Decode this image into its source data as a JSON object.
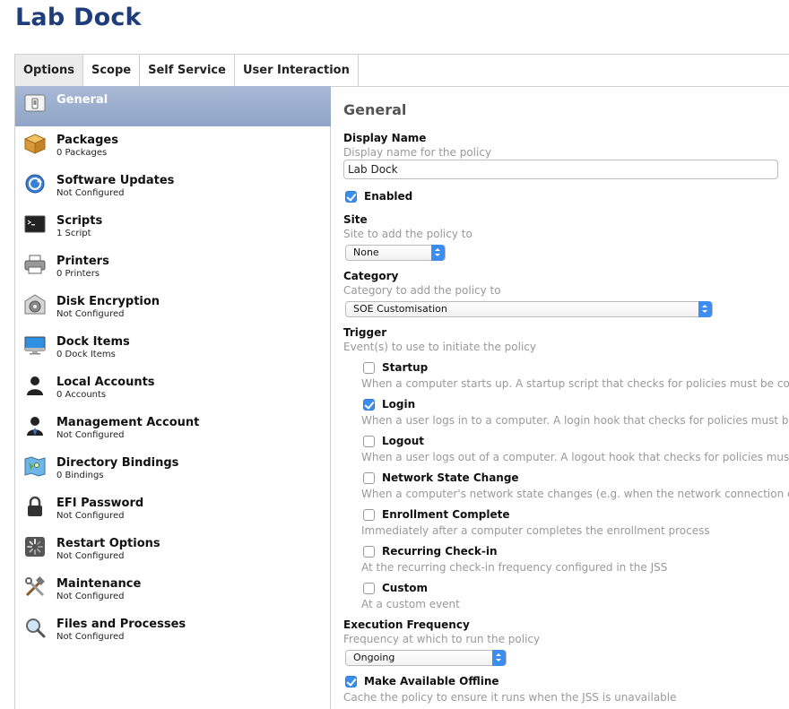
{
  "page": {
    "title": "Lab Dock"
  },
  "tabs": [
    {
      "label": "Options"
    },
    {
      "label": "Scope"
    },
    {
      "label": "Self Service"
    },
    {
      "label": "User Interaction"
    }
  ],
  "sidebar": {
    "items": [
      {
        "label": "General",
        "sub": "",
        "icon": "switch-icon"
      },
      {
        "label": "Packages",
        "sub": "0 Packages",
        "icon": "package-icon"
      },
      {
        "label": "Software Updates",
        "sub": "Not Configured",
        "icon": "software-update-icon"
      },
      {
        "label": "Scripts",
        "sub": "1 Script",
        "icon": "terminal-icon"
      },
      {
        "label": "Printers",
        "sub": "0 Printers",
        "icon": "printer-icon"
      },
      {
        "label": "Disk Encryption",
        "sub": "Not Configured",
        "icon": "disk-encryption-icon"
      },
      {
        "label": "Dock Items",
        "sub": "0 Dock Items",
        "icon": "monitor-icon"
      },
      {
        "label": "Local Accounts",
        "sub": "0 Accounts",
        "icon": "user-icon"
      },
      {
        "label": "Management Account",
        "sub": "Not Configured",
        "icon": "admin-user-icon"
      },
      {
        "label": "Directory Bindings",
        "sub": "0 Bindings",
        "icon": "map-icon"
      },
      {
        "label": "EFI Password",
        "sub": "Not Configured",
        "icon": "lock-icon"
      },
      {
        "label": "Restart Options",
        "sub": "Not Configured",
        "icon": "spinner-icon"
      },
      {
        "label": "Maintenance",
        "sub": "Not Configured",
        "icon": "tools-icon"
      },
      {
        "label": "Files and Processes",
        "sub": "Not Configured",
        "icon": "magnifier-icon"
      }
    ]
  },
  "general": {
    "section_title": "General",
    "display_name": {
      "label": "Display Name",
      "help": "Display name for the policy",
      "value": "Lab Dock"
    },
    "enabled": {
      "label": "Enabled",
      "checked": true
    },
    "site": {
      "label": "Site",
      "help": "Site to add the policy to",
      "value": "None"
    },
    "category": {
      "label": "Category",
      "help": "Category to add the policy to",
      "value": "SOE Customisation"
    },
    "trigger": {
      "label": "Trigger",
      "help": "Event(s) to use to initiate the policy",
      "options": [
        {
          "label": "Startup",
          "help": "When a computer starts up. A startup script that checks for policies must be confi",
          "checked": false
        },
        {
          "label": "Login",
          "help": "When a user logs in to a computer. A login hook that checks for policies must be c",
          "checked": true
        },
        {
          "label": "Logout",
          "help": "When a user logs out of a computer. A logout hook that checks for policies must b",
          "checked": false
        },
        {
          "label": "Network State Change",
          "help": "When a computer's network state changes (e.g. when the network connection char",
          "checked": false
        },
        {
          "label": "Enrollment Complete",
          "help": "Immediately after a computer completes the enrollment process",
          "checked": false
        },
        {
          "label": "Recurring Check-in",
          "help": "At the recurring check-in frequency configured in the JSS",
          "checked": false
        },
        {
          "label": "Custom",
          "help": "At a custom event",
          "checked": false
        }
      ]
    },
    "execution_frequency": {
      "label": "Execution Frequency",
      "help": "Frequency at which to run the policy",
      "value": "Ongoing"
    },
    "offline": {
      "label": "Make Available Offline",
      "help": "Cache the policy to ensure it runs when the JSS is unavailable",
      "checked": true
    }
  },
  "colors": {
    "title": "#1f3d7a",
    "selected_row": "#9fb1cf",
    "checkbox_accent": "#3b8ef0"
  }
}
